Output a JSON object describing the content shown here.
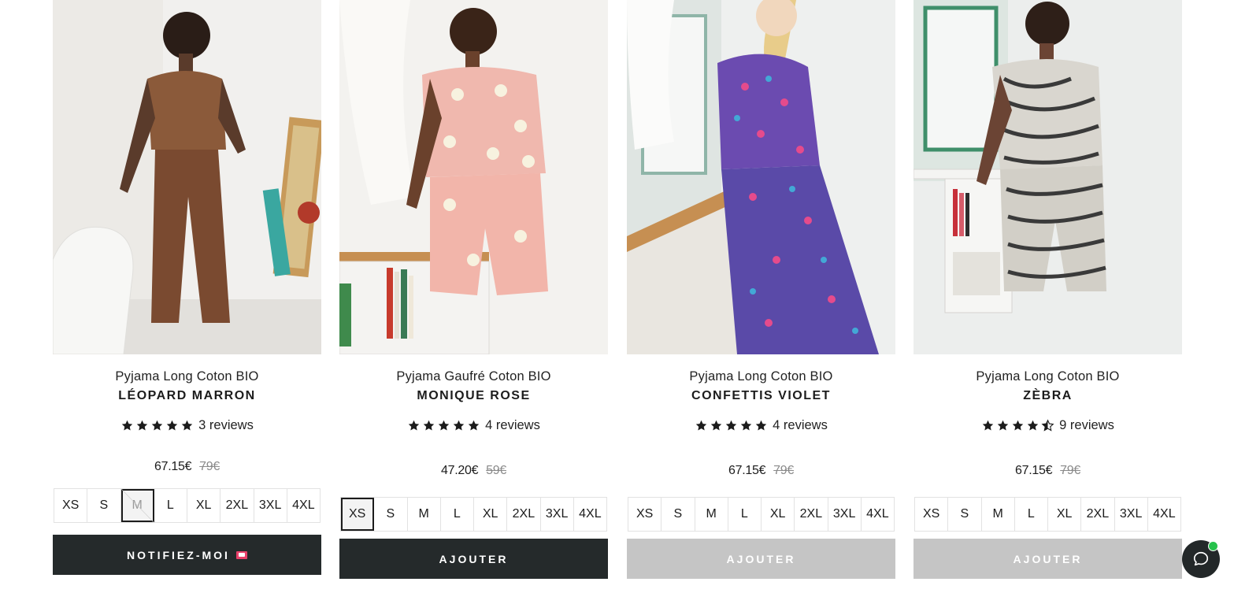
{
  "products": [
    {
      "subtitle": "Pyjama Long Coton BIO",
      "name": "LÉOPARD MARRON",
      "rating": 5,
      "reviews": "3 reviews",
      "price": "67.15€",
      "compare_price": "79€",
      "sizes": [
        "XS",
        "S",
        "M",
        "L",
        "XL",
        "2XL",
        "3XL",
        "4XL"
      ],
      "selected_size": "M",
      "unavailable_sizes": [
        "M"
      ],
      "cta": "NOTIFIEZ-MOI",
      "cta_style": "dark",
      "image_icon": "pyjama-photo-leopard"
    },
    {
      "subtitle": "Pyjama Gaufré Coton BIO",
      "name": "MONIQUE ROSE",
      "rating": 5,
      "reviews": "4 reviews",
      "price": "47.20€",
      "compare_price": "59€",
      "sizes": [
        "XS",
        "S",
        "M",
        "L",
        "XL",
        "2XL",
        "3XL",
        "4XL"
      ],
      "selected_size": "XS",
      "unavailable_sizes": [],
      "cta": "AJOUTER",
      "cta_style": "dark",
      "image_icon": "pyjama-photo-rose"
    },
    {
      "subtitle": "Pyjama Long Coton BIO",
      "name": "CONFETTIS VIOLET",
      "rating": 5,
      "reviews": "4 reviews",
      "price": "67.15€",
      "compare_price": "79€",
      "sizes": [
        "XS",
        "S",
        "M",
        "L",
        "XL",
        "2XL",
        "3XL",
        "4XL"
      ],
      "selected_size": "",
      "unavailable_sizes": [],
      "cta": "AJOUTER",
      "cta_style": "disabled",
      "image_icon": "pyjama-photo-violet"
    },
    {
      "subtitle": "Pyjama Long Coton BIO",
      "name": "ZÈBRA",
      "rating": 4.5,
      "reviews": "9 reviews",
      "price": "67.15€",
      "compare_price": "79€",
      "sizes": [
        "XS",
        "S",
        "M",
        "L",
        "XL",
        "2XL",
        "3XL",
        "4XL"
      ],
      "selected_size": "",
      "unavailable_sizes": [],
      "cta": "AJOUTER",
      "cta_style": "disabled",
      "image_icon": "pyjama-photo-zebra"
    }
  ],
  "colors": {
    "cta_dark": "#252a2b",
    "cta_disabled": "#c5c5c5",
    "notify_envelope": "#e8406a",
    "chat_online": "#27c24c"
  },
  "chat": {
    "icon": "chat-bubble-icon",
    "status": "online"
  }
}
